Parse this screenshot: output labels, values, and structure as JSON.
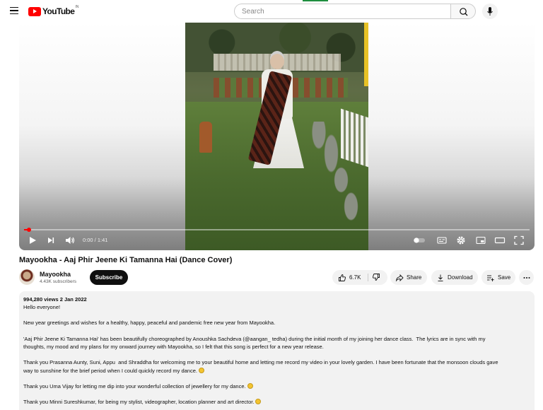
{
  "header": {
    "brand": "YouTube",
    "region": "IN",
    "search_placeholder": "Search"
  },
  "player": {
    "time": "0:00 / 1:41",
    "progress": 0.01
  },
  "video": {
    "title": "Mayookha - Aaj Phir Jeene Ki Tamanna Hai (Dance Cover)"
  },
  "channel": {
    "name": "Mayookha",
    "subscribers": "4.43K subscribers",
    "subscribe_label": "Subscribe"
  },
  "actions": {
    "likes": "6.7K",
    "share": "Share",
    "download": "Download",
    "save": "Save"
  },
  "description": {
    "meta": "994,280 views  2 Jan 2022",
    "lines": [
      "Hello everyone!",
      "",
      "New year greetings and wishes for a healthy, happy, peaceful and pandemic free new year from Mayookha.",
      "",
      "'Aaj Phir Jeene Ki Tamanna Hai' has been beautifully choreographed by Anoushka Sachdeva (@aangan_ tedha) during the initial month of my joining her dance class.  The lyrics are in sync with my",
      "thoughts, my mood and my plans for my onward journey with Mayookha, so I felt that this song is perfect for a new year release.",
      "",
      "Thank you Prasanna Aunty, Suni, Appu  and Shraddha for welcoming me to your beautiful home and letting me record my video in your lovely garden. I have been fortunate that the monsoon clouds gave",
      "way to sunshine for the brief period when I could quickly record my dance.",
      "",
      "Thank you Uma Vijay for letting me dip into your wonderful collection of jewellery for my dance.",
      "",
      "Thank you Minni Sureshkumar, for being my stylist, videographer, location planner and art director."
    ]
  },
  "colors": {
    "accent": "#ff0000",
    "subscribe_bg": "#0f0f0f",
    "pill_bg": "#f2f2f2"
  }
}
